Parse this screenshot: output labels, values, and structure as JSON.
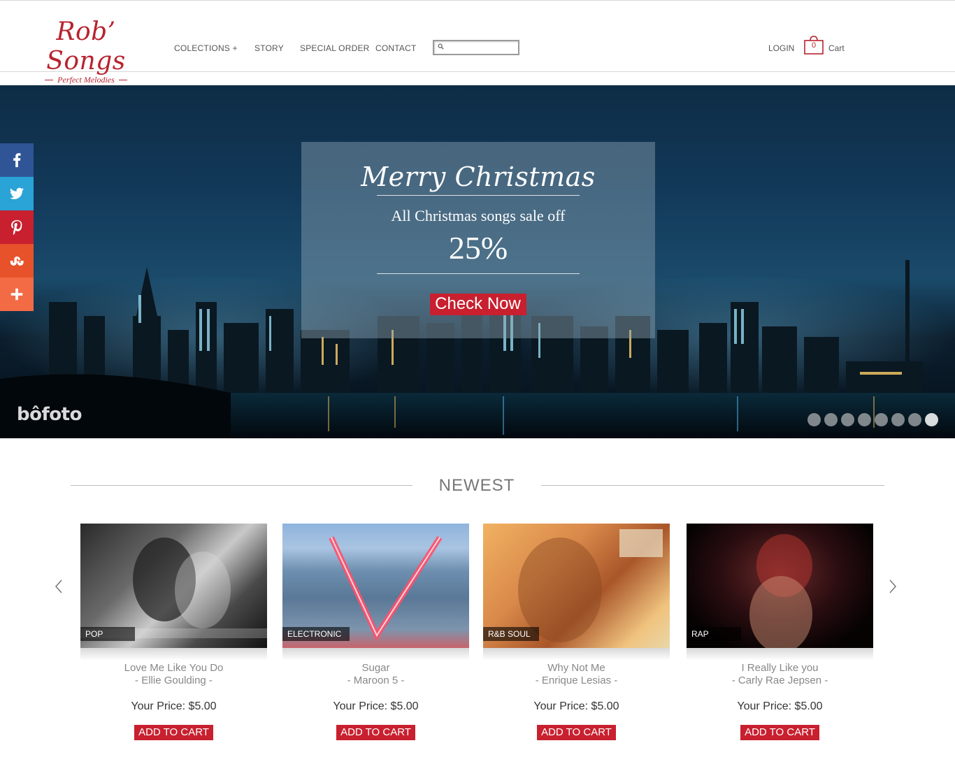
{
  "brand": {
    "name": "Rob’ Songs",
    "tagline": "Perfect Melodies",
    "color": "#b8232f"
  },
  "nav": {
    "items": [
      {
        "label": "COLECTIONS +"
      },
      {
        "label": "STORY"
      },
      {
        "label": "SPECIAL ORDER"
      },
      {
        "label": "CONTACT"
      }
    ],
    "login": "LOGIN",
    "cart_count": "0",
    "cart_label": "Cart"
  },
  "search": {
    "placeholder": "",
    "value": ""
  },
  "hero": {
    "title": "Merry Christmas",
    "subtitle": "All Christmas songs sale off",
    "discount": "25%",
    "button": "Check Now",
    "watermark": "bôfoto",
    "slide_count": 8,
    "active_slide": 8
  },
  "social": [
    {
      "name": "facebook-icon",
      "color": "#2f5597"
    },
    {
      "name": "twitter-icon",
      "color": "#2aa3d6"
    },
    {
      "name": "pinterest-icon",
      "color": "#c8202f"
    },
    {
      "name": "stumbleupon-icon",
      "color": "#e8522a"
    },
    {
      "name": "share-more-icon",
      "color": "#f26b45"
    }
  ],
  "newest": {
    "heading": "NEWEST",
    "products": [
      {
        "genre": "POP",
        "title": "Love Me Like You Do",
        "artist": "- Ellie Goulding -",
        "price": "Your Price: $5.00",
        "button": "ADD TO CART"
      },
      {
        "genre": "ELECTRONIC",
        "title": "Sugar",
        "artist": "- Maroon 5 -",
        "price": "Your Price: $5.00",
        "button": "ADD TO CART"
      },
      {
        "genre": "R&B SOUL",
        "title": "Why Not Me",
        "artist": "- Enrique Lesias -",
        "price": "Your Price: $5.00",
        "button": "ADD TO CART"
      },
      {
        "genre": "RAP",
        "title": "I Really Like you",
        "artist": "- Carly Rae Jepsen -",
        "price": "Your Price: $5.00",
        "button": "ADD TO CART"
      }
    ]
  },
  "accent_color": "#c8202f"
}
